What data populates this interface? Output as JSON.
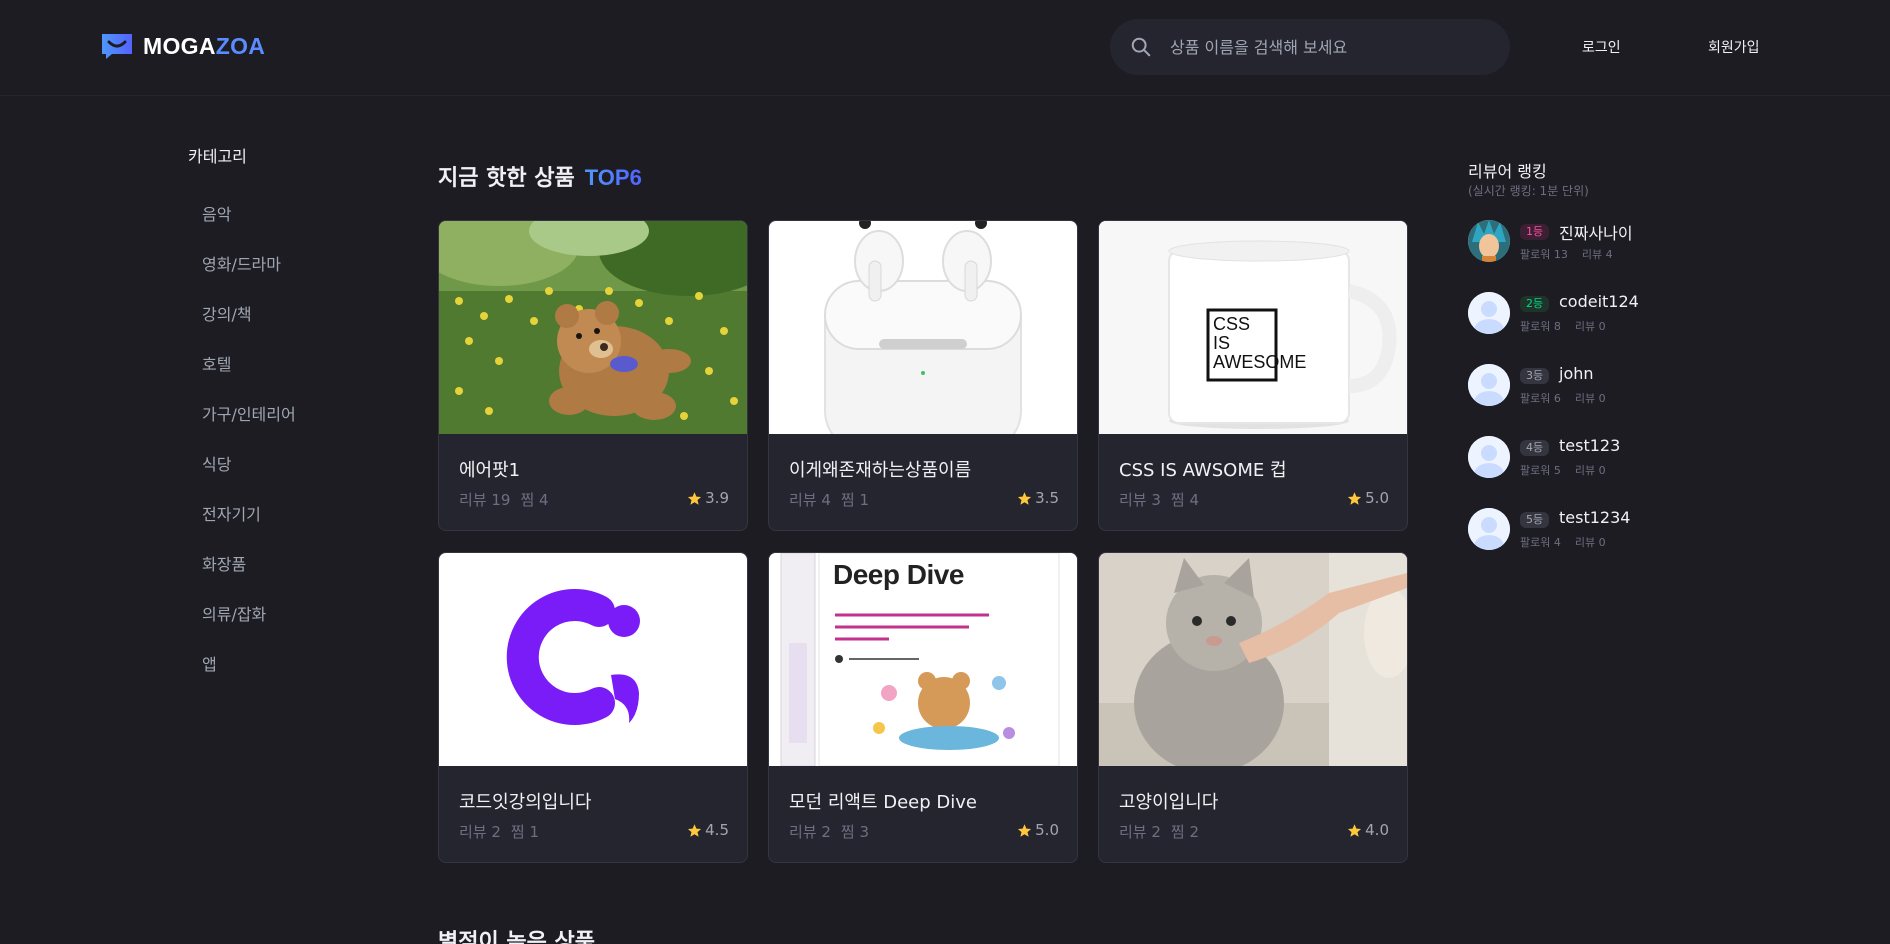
{
  "header": {
    "logo_main": "MOGA",
    "logo_accent": "ZOA",
    "search_placeholder": "상품 이름을 검색해 보세요",
    "login_label": "로그인",
    "signup_label": "회원가입"
  },
  "sidebar": {
    "title": "카테고리",
    "items": [
      {
        "label": "음악"
      },
      {
        "label": "영화/드라마"
      },
      {
        "label": "강의/책"
      },
      {
        "label": "호텔"
      },
      {
        "label": "가구/인테리어"
      },
      {
        "label": "식당"
      },
      {
        "label": "전자기기"
      },
      {
        "label": "화장품"
      },
      {
        "label": "의류/잡화"
      },
      {
        "label": "앱"
      }
    ]
  },
  "hot": {
    "title": "지금 핫한 상품",
    "badge": "TOP6",
    "products": [
      {
        "name": "에어팟1",
        "reviews": "리뷰 19",
        "likes": "찜 4",
        "rating": "3.9",
        "image": "teddy-bear-photo"
      },
      {
        "name": "이게왜존재하는상품이름",
        "reviews": "리뷰 4",
        "likes": "찜 1",
        "rating": "3.5",
        "image": "airpods-photo"
      },
      {
        "name": "CSS IS AWSOME 컵",
        "reviews": "리뷰 3",
        "likes": "찜 4",
        "rating": "5.0",
        "image": "mug-photo"
      },
      {
        "name": "코드잇강의입니다",
        "reviews": "리뷰 2",
        "likes": "찜 1",
        "rating": "4.5",
        "image": "codeit-logo"
      },
      {
        "name": "모던 리액트 Deep Dive",
        "reviews": "리뷰 2",
        "likes": "찜 3",
        "rating": "5.0",
        "image": "book-cover"
      },
      {
        "name": "고양이입니다",
        "reviews": "리뷰 2",
        "likes": "찜 2",
        "rating": "4.0",
        "image": "cat-photo"
      }
    ],
    "mug_text": [
      "CSS",
      "IS",
      "AWESOME"
    ],
    "book_title": "Deep Dive"
  },
  "second_section_title": "별점이 높은 상품",
  "ranking": {
    "title": "리뷰어 랭킹",
    "subtitle": "(실시간 랭킹: 1분 단위)",
    "reviewers": [
      {
        "rank": "1등",
        "name": "진짜사나이",
        "followers": "팔로워 13",
        "reviews": "리뷰 4",
        "badge_bg": "#3b1f33",
        "badge_fg": "#ff4fa1"
      },
      {
        "rank": "2등",
        "name": "codeit124",
        "followers": "팔로워 8",
        "reviews": "리뷰 0",
        "badge_bg": "#1f3329",
        "badge_fg": "#05d58b"
      },
      {
        "rank": "3등",
        "name": "john",
        "followers": "팔로워 6",
        "reviews": "리뷰 0",
        "badge_bg": "#35353f",
        "badge_fg": "#9fa6b2"
      },
      {
        "rank": "4등",
        "name": "test123",
        "followers": "팔로워 5",
        "reviews": "리뷰 0",
        "badge_bg": "#35353f",
        "badge_fg": "#9fa6b2"
      },
      {
        "rank": "5등",
        "name": "test1234",
        "followers": "팔로워 4",
        "reviews": "리뷰 0",
        "badge_bg": "#35353f",
        "badge_fg": "#9fa6b2"
      }
    ]
  },
  "colors": {
    "background": "#1c1c22",
    "card": "#252530",
    "accent": "#5a8bff",
    "star": "#ffc83c"
  }
}
